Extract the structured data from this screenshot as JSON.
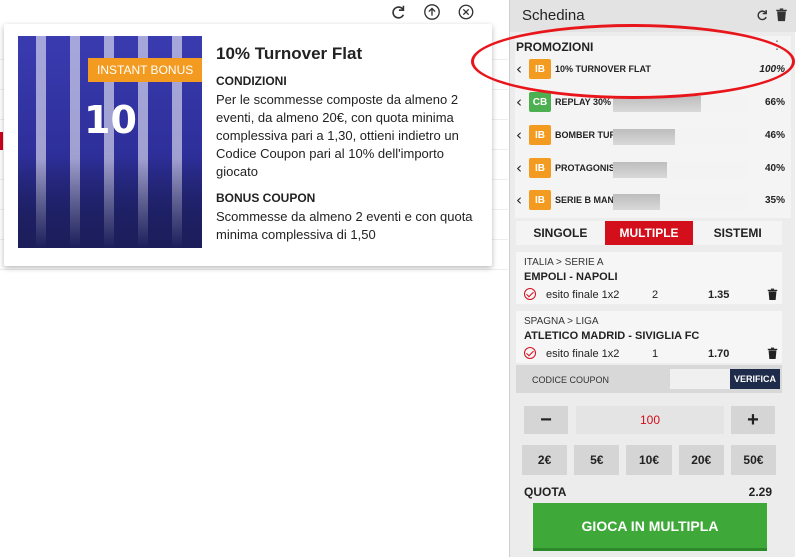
{
  "popup": {
    "badge": "INSTANT BONUS",
    "jersey_number": "10",
    "title": "10% Turnover Flat",
    "sections": [
      {
        "heading": "CONDIZIONI",
        "text": "Per le scommesse composte da almeno 2 eventi, da almeno 20€, con quota minima complessiva pari a 1,30, ottieni indietro un Codice Coupon pari al 10% dell'importo giocato"
      },
      {
        "heading": "BONUS COUPON",
        "text": "Scommesse da almeno 2 eventi e con quota minima complessiva di 1,50"
      }
    ],
    "icons": [
      "refresh-icon",
      "upload-icon",
      "close-icon"
    ]
  },
  "panel": {
    "title": "Schedina",
    "promotions_label": "PROMOZIONI",
    "promotions": [
      {
        "badge": "IB",
        "badge_color": "#f39b20",
        "name": "10% TURNOVER FLAT",
        "progress": 100,
        "percent": "100%"
      },
      {
        "badge": "CB",
        "badge_color": "#4caf50",
        "name": "REPLAY 30%",
        "progress": 66,
        "percent": "66%"
      },
      {
        "badge": "IB",
        "badge_color": "#f39b20",
        "name": "BOMBER TURNOVER 20%",
        "progress": 46,
        "percent": "46%"
      },
      {
        "badge": "IB",
        "badge_color": "#f39b20",
        "name": "PROTAGONIST... A",
        "progress": 40,
        "percent": "40%"
      },
      {
        "badge": "IB",
        "badge_color": "#f39b20",
        "name": "SERIE B MANIA",
        "progress": 35,
        "percent": "35%"
      }
    ],
    "tabs": [
      {
        "label": "SINGOLE",
        "active": false
      },
      {
        "label": "MULTIPLE",
        "active": true
      },
      {
        "label": "SISTEMI",
        "active": false
      }
    ],
    "bets": [
      {
        "league": "ITALIA > SERIE A",
        "event": "EMPOLI - NAPOLI",
        "market": "esito finale 1x2",
        "selection": "2",
        "odds": "1.35"
      },
      {
        "league": "SPAGNA > LIGA",
        "event": "ATLETICO MADRID - SIVIGLIA FC",
        "market": "esito finale 1x2",
        "selection": "1",
        "odds": "1.70"
      }
    ],
    "coupon": {
      "label": "CODICE COUPON",
      "button": "VERIFICA",
      "value": ""
    },
    "stake": {
      "minus": "−",
      "value": "100",
      "plus": "+"
    },
    "quick_amounts": [
      "2€",
      "5€",
      "10€",
      "20€",
      "50€"
    ],
    "quota_label": "QUOTA",
    "quota_value": "2.29",
    "play_button": "GIOCA IN MULTIPLA"
  },
  "colors": {
    "accent_red": "#d30f1c",
    "play_green": "#3ea839",
    "badge_orange": "#f39b20",
    "badge_green": "#4caf50",
    "verify_navy": "#1e2b4a",
    "highlight_ring": "#e8151b"
  }
}
